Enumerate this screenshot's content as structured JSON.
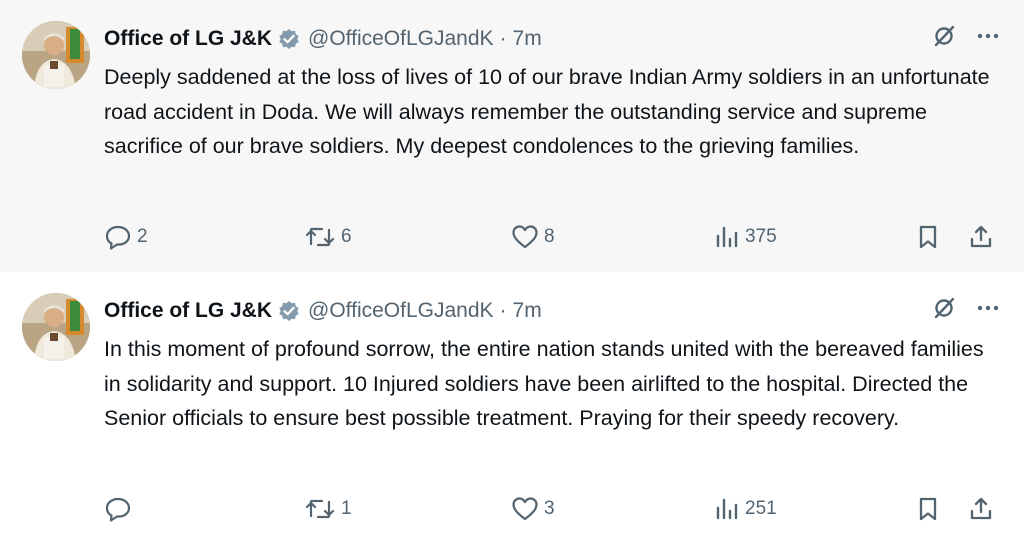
{
  "tweets": [
    {
      "author_name": "Office of LG J&K",
      "handle": "@OfficeOfLGJandK",
      "separator": "·",
      "time": "7m",
      "text": "Deeply saddened at the loss of lives of 10 of our brave Indian Army soldiers in an unfortunate road accident in Doda. We will always remember the outstanding service and supreme sacrifice of our brave soldiers. My deepest condolences to the grieving families.",
      "replies": "2",
      "retweets": "6",
      "likes": "8",
      "views": "375"
    },
    {
      "author_name": "Office of LG J&K",
      "handle": "@OfficeOfLGJandK",
      "separator": "·",
      "time": "7m",
      "text": "In this moment of profound sorrow, the entire nation stands united with the bereaved families in solidarity and support. 10 Injured soldiers have been airlifted to the hospital. Directed the Senior officials to ensure best possible treatment. Praying for their speedy recovery.",
      "replies": "",
      "retweets": "1",
      "likes": "3",
      "views": "251"
    }
  ],
  "icons": {
    "verified": "verified-badge-icon",
    "grok": "grok-icon",
    "more": "more-icon",
    "reply": "reply-icon",
    "retweet": "retweet-icon",
    "like": "heart-icon",
    "views": "views-icon",
    "bookmark": "bookmark-icon",
    "share": "share-icon"
  },
  "colors": {
    "text": "#0f1419",
    "muted": "#536471",
    "verified_badge": "#829aab",
    "first_tweet_bg": "#f7f7f7",
    "thread_line": "#cfd9de"
  }
}
